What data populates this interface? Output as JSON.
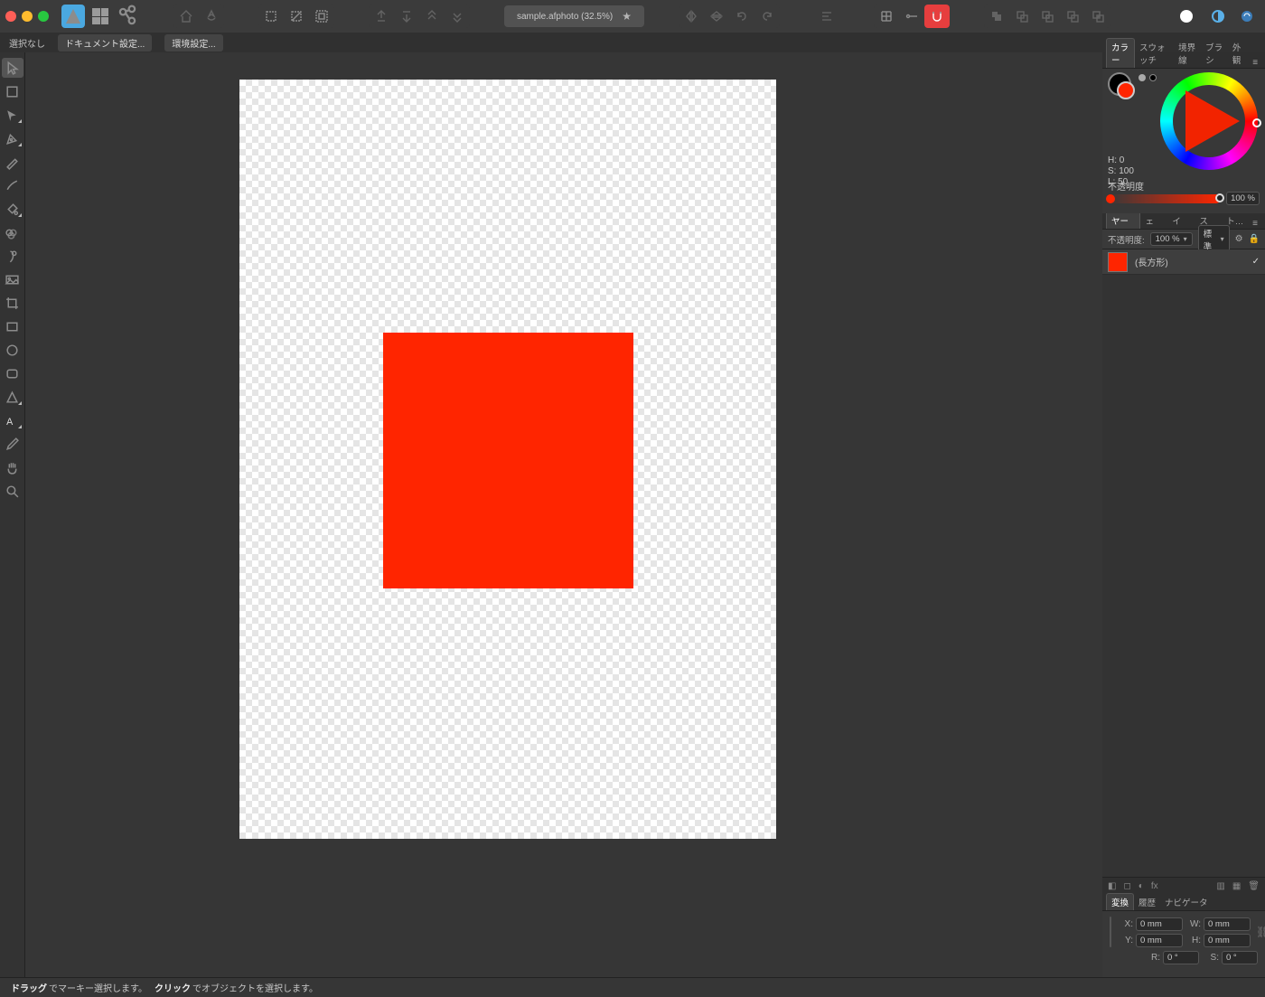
{
  "document": {
    "title": "sample.afphoto",
    "zoom": "32.5%"
  },
  "ctx": {
    "noselect": "選択なし",
    "docsetup": "ドキュメント設定...",
    "prefs": "環境設定..."
  },
  "status": {
    "drag_b": "ドラッグ",
    "drag_t": "でマーキー選択します。",
    "click_b": "クリック",
    "click_t": "でオブジェクトを選択します。"
  },
  "panel": {
    "colour_tabs": {
      "colour": "カラー",
      "swatches": "スウォッチ",
      "stroke": "境界線",
      "brushes": "ブラシ",
      "appearance": "外観"
    },
    "layer_tabs": {
      "layers": "レイヤー",
      "effects": "エフェ",
      "styles": "スタイ",
      "text": "テキス",
      "stock": "スト…"
    },
    "xform_tabs": {
      "xform": "変換",
      "history": "履歴",
      "nav": "ナビゲータ"
    }
  },
  "colour": {
    "h_lbl": "H: 0",
    "s_lbl": "S: 100",
    "l_lbl": "L: 50",
    "opacity_lbl": "不透明度",
    "opacity_val": "100 %",
    "primary": "#ff2500"
  },
  "layers": {
    "op_lbl": "不透明度:",
    "op_val": "100 %",
    "blend": "標準",
    "item_name": "(長方形)"
  },
  "xform": {
    "x_lbl": "X:",
    "y_lbl": "Y:",
    "w_lbl": "W:",
    "h_lbl": "H:",
    "r_lbl": "R:",
    "s_lbl": "S:",
    "x": "0 mm",
    "y": "0 mm",
    "w": "0 mm",
    "h": "0 mm",
    "r": "0 °",
    "s": "0 °"
  }
}
